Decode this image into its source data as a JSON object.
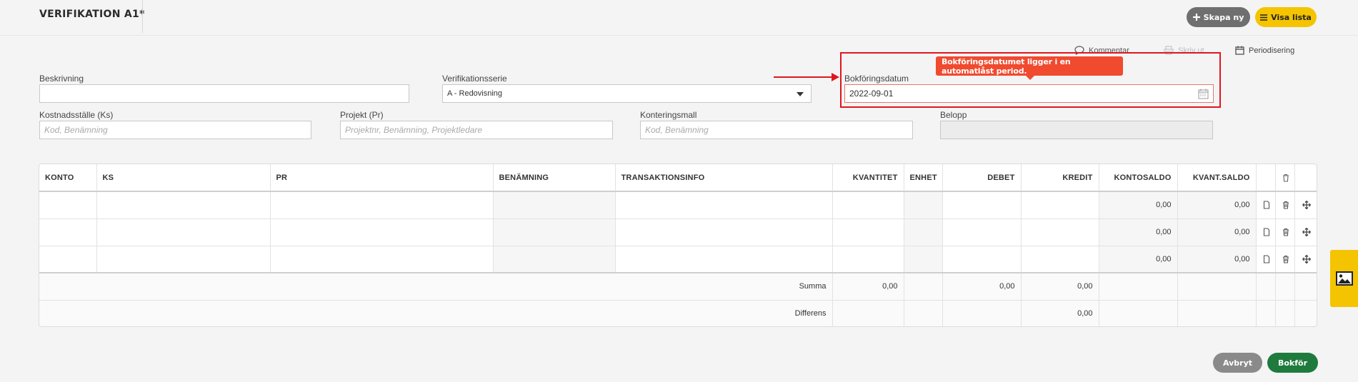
{
  "header": {
    "title": "VERIFIKATION A1*",
    "new_button": "Skapa ny",
    "list_button": "Visa lista"
  },
  "actions": {
    "comment": "Kommentar",
    "print": "Skriv ut",
    "periodization": "Periodisering"
  },
  "form": {
    "description_label": "Beskrivning",
    "description_value": "",
    "series_label": "Verifikationsserie",
    "series_value": "A - Redovisning",
    "date_label": "Bokföringsdatum",
    "date_value": "2022-09-01",
    "date_tooltip": "Bokföringsdatumet ligger i en automatlåst period.",
    "cost_center_label": "Kostnadsställe (Ks)",
    "cost_center_placeholder": "Kod, Benämning",
    "project_label": "Projekt (Pr)",
    "project_placeholder": "Projektnr, Benämning, Projektledare",
    "template_label": "Konteringsmall",
    "template_placeholder": "Kod, Benämning",
    "amount_label": "Belopp",
    "amount_value": ""
  },
  "table": {
    "columns": [
      "KONTO",
      "KS",
      "PR",
      "BENÄMNING",
      "TRANSAKTIONSINFO",
      "KVANTITET",
      "ENHET",
      "DEBET",
      "KREDIT",
      "KONTOSALDO",
      "KVANT.SALDO"
    ],
    "rows": [
      {
        "kontosaldo": "0,00",
        "kvantsaldo": "0,00"
      },
      {
        "kontosaldo": "0,00",
        "kvantsaldo": "0,00"
      },
      {
        "kontosaldo": "0,00",
        "kvantsaldo": "0,00"
      }
    ],
    "sum": {
      "label": "Summa",
      "kvantitet": "0,00",
      "debet": "0,00",
      "kredit": "0,00"
    },
    "diff": {
      "label": "Differens",
      "kredit": "0,00"
    }
  },
  "footer": {
    "cancel_button": "Avbryt",
    "book_button": "Bokför"
  },
  "colors": {
    "accent_yellow": "#f5c400",
    "book_green": "#1e7b3d",
    "alert_red": "#e0161e",
    "tooltip_orange": "#f04a2f"
  }
}
